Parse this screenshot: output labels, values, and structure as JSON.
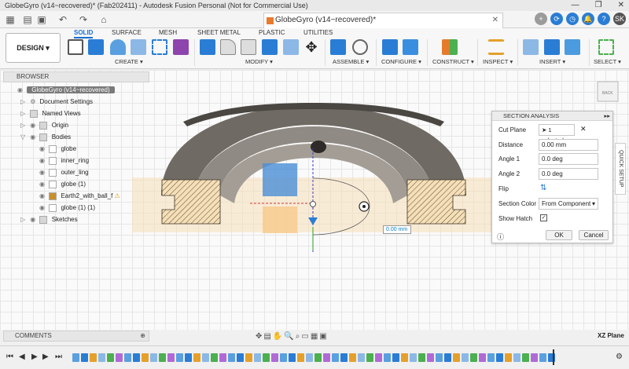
{
  "titlebar": {
    "title": "GlobeGyro (v14~recovered)* (Fab202411) - Autodesk Fusion Personal (Not for Commercial Use)",
    "minimize": "—",
    "maximize": "❐",
    "close": "✕"
  },
  "document_tab": {
    "label": "GlobeGyro (v14~recovered)*",
    "close": "✕"
  },
  "user_initials": "SK",
  "workspace": {
    "label": "DESIGN",
    "caret": "▾"
  },
  "mode_tabs": [
    "SOLID",
    "SURFACE",
    "MESH",
    "SHEET METAL",
    "PLASTIC",
    "UTILITIES"
  ],
  "tool_groups": [
    "CREATE",
    "MODIFY",
    "ASSEMBLE",
    "CONFIGURE",
    "CONSTRUCT",
    "INSPECT",
    "INSERT",
    "SELECT"
  ],
  "browser": {
    "title": "BROWSER",
    "root": "GlobeGyro (v14~recovered)",
    "items": [
      {
        "label": "Document Settings"
      },
      {
        "label": "Named Views"
      },
      {
        "label": "Origin"
      },
      {
        "label": "Bodies"
      },
      {
        "label": "globe"
      },
      {
        "label": "inner_ring"
      },
      {
        "label": "outer_ling"
      },
      {
        "label": "globe (1)"
      },
      {
        "label": "Earth2_with_ball_f"
      },
      {
        "label": "globe (1) (1)"
      },
      {
        "label": "Sketches"
      }
    ]
  },
  "section_analysis": {
    "title": "SECTION ANALYSIS",
    "cut_plane_label": "Cut Plane",
    "cut_plane_value": "1 selected",
    "distance_label": "Distance",
    "distance_value": "0.00 mm",
    "angle1_label": "Angle 1",
    "angle1_value": "0.0 deg",
    "angle2_label": "Angle 2",
    "angle2_value": "0.0 deg",
    "flip_label": "Flip",
    "section_color_label": "Section Color",
    "section_color_value": "From Component",
    "show_hatch_label": "Show Hatch",
    "show_hatch_checked": true,
    "ok_label": "OK",
    "cancel_label": "Cancel"
  },
  "quick_setup": "QUICK SETUP",
  "viewcube_label": "BACK",
  "viewport_input": "0.00 mm",
  "comments": "COMMENTS",
  "view_plane": "XZ Plane",
  "colors": {
    "accent": "#1a6fd1",
    "body_dark": "#6f6a63",
    "body_light": "#a39d95",
    "section_fill": "#f5dfb8",
    "section_blue": "#4b8fd6",
    "section_orange": "#f7c98a"
  }
}
